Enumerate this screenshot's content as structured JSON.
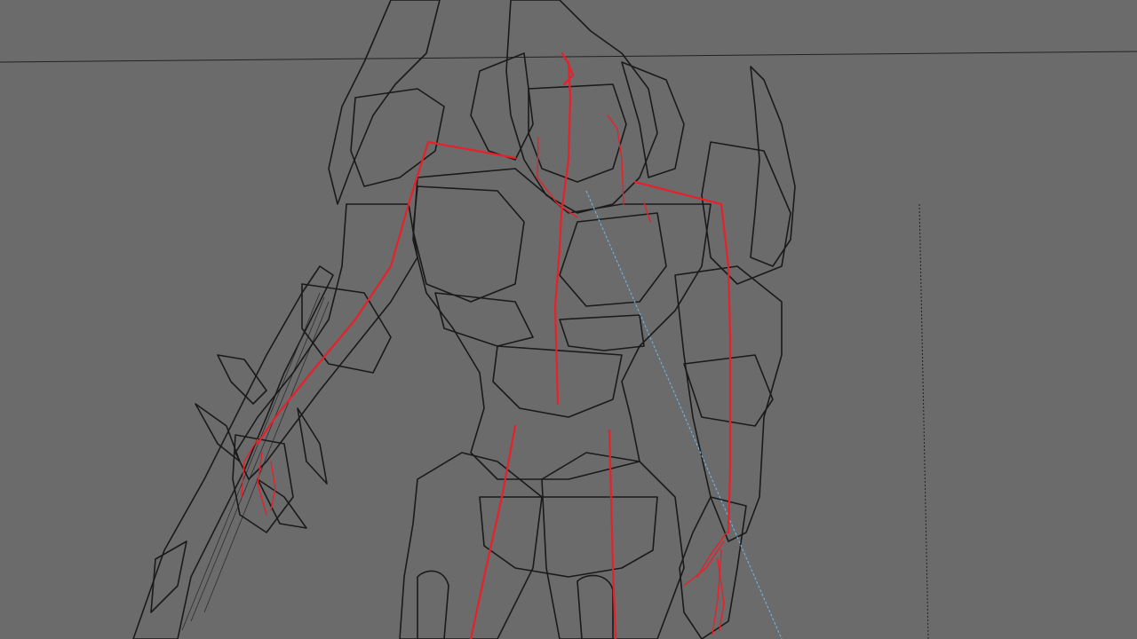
{
  "viewport": {
    "mode": "wireframe",
    "background_color": "#6b6b6b",
    "wire_color": "#1a1a1a",
    "bone_color": "#e8202a",
    "camera_ray_color": "#7fb3d9"
  },
  "scene": {
    "model": "armored-alien-warrior",
    "rig": "skeleton-bones",
    "prop": "energy-sword"
  }
}
